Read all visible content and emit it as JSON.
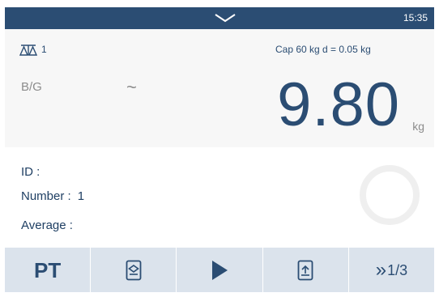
{
  "status_bar": {
    "time": "15:35",
    "accent": "#2b4d73"
  },
  "weighing": {
    "scale_number": "1",
    "capacity": "Cap 60 kg d = 0.05 kg",
    "mode_label": "B/G",
    "stability_indicator": "~",
    "weight_value": "9.80",
    "unit": "kg"
  },
  "info": {
    "id_label": "ID :",
    "id_value": "",
    "number_label": "Number :",
    "number_value": "1",
    "average_label": "Average :",
    "average_value": ""
  },
  "softkeys": {
    "pt_label": "PT",
    "templates_icon": "template-icon",
    "start_icon": "play-icon",
    "transfer_icon": "transfer-icon",
    "next_arrows": "»",
    "page_indicator": "1/3"
  }
}
